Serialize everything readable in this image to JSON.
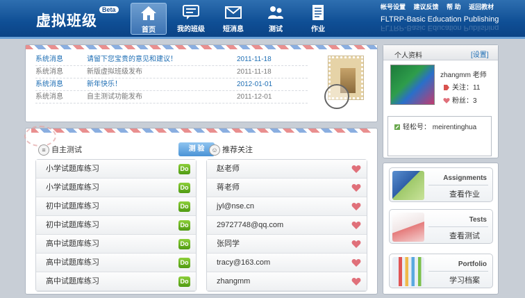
{
  "header": {
    "logo": "虚拟班级",
    "beta": "Beta",
    "nav": [
      {
        "label": "首页",
        "icon": "home-icon"
      },
      {
        "label": "我的班级",
        "icon": "chat-icon"
      },
      {
        "label": "短消息",
        "icon": "envelope-icon"
      },
      {
        "label": "测试",
        "icon": "people-icon"
      },
      {
        "label": "作业",
        "icon": "document-icon"
      }
    ],
    "toplinks": [
      "帐号设置",
      "建议反馈",
      "帮 助",
      "返回教材"
    ],
    "brand": "FLTRP-Basic Education Publishing"
  },
  "messages": [
    {
      "type": "系统消息",
      "content": "请留下您宝贵的意见和建议！",
      "date": "2011-11-18",
      "unread": true
    },
    {
      "type": "系统消息",
      "content": "新版虚拟班级发布",
      "date": "2011-11-18",
      "unread": false
    },
    {
      "type": "系统消息",
      "content": "新年快乐！",
      "date": "2012-01-01",
      "unread": true
    },
    {
      "type": "系统消息",
      "content": "自主测试功能发布",
      "date": "2011-12-01",
      "unread": false
    }
  ],
  "self_test": {
    "title": "自主测试",
    "button": "测 验",
    "do_label": "Do",
    "items": [
      "小学试题库练习",
      "小学试题库练习",
      "初中试题库练习",
      "初中试题库练习",
      "高中试题库练习",
      "高中试题库练习",
      "高中试题库练习"
    ]
  },
  "recommend": {
    "title": "推荐关注",
    "items": [
      "赵老师",
      "蒋老师",
      "jyl@nse.cn",
      "29727748@qq.com",
      "张同学",
      "tracy@163.com",
      "zhangmm"
    ]
  },
  "profile": {
    "title": "个人资料",
    "settings": "[设置]",
    "name": "zhangmm 老师",
    "follow": "关注：11",
    "fans": "粉丝：3",
    "easy_no": "轻松号： meirentinghua"
  },
  "cards": [
    {
      "en": "Assignments",
      "zh": "查看作业"
    },
    {
      "en": "Tests",
      "zh": "查看测试"
    },
    {
      "en": "Portfolio",
      "zh": "学习档案"
    }
  ],
  "colors": {
    "header": "#0f4f95",
    "link": "#1e6eb4",
    "do_green": "#5fa91a",
    "heart": "#e0707a"
  }
}
